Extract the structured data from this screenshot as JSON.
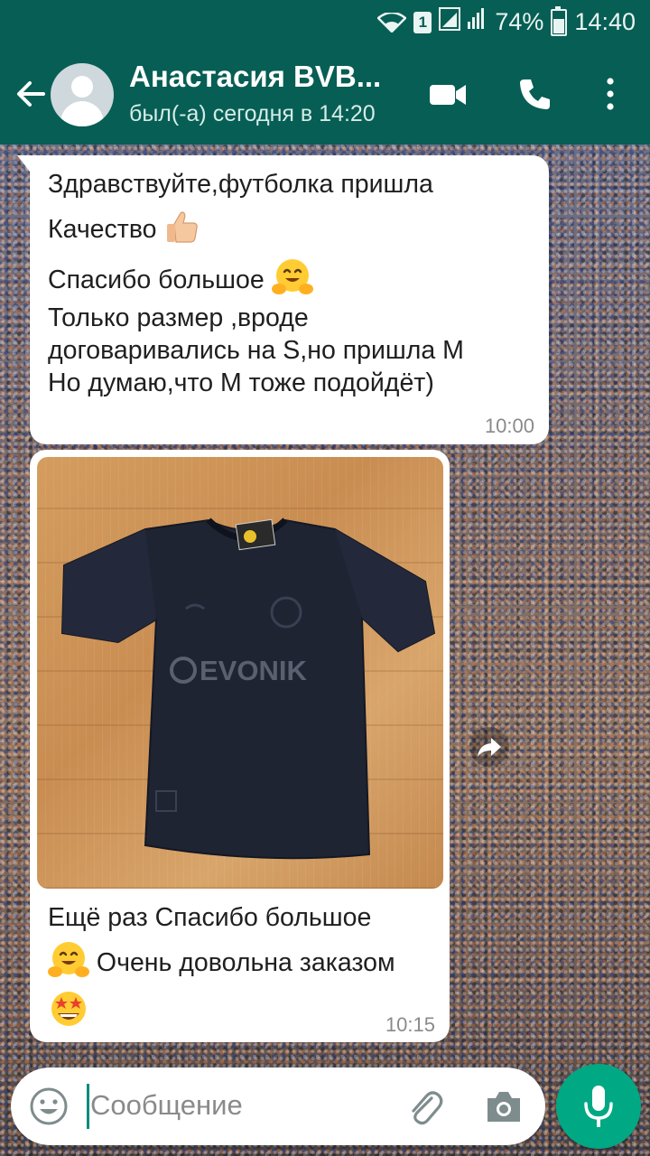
{
  "status_bar": {
    "sim_slot": "1",
    "battery": "74%",
    "battery_level": 0.74,
    "time": "14:40"
  },
  "header": {
    "contact_name": "Анастасия BVB...",
    "last_seen": "был(-а) сегодня в 14:20",
    "icons": [
      "back-arrow-icon",
      "video-call-icon",
      "phone-icon",
      "more-vert-icon"
    ]
  },
  "messages": [
    {
      "lines": [
        "Здравствуйте,футболка пришла",
        "Качество",
        "Спасибо большое",
        "Только размер ,вроде",
        "договаривались на S,но пришла M",
        "Но думаю,что M тоже подойдёт)"
      ],
      "time": "10:00"
    },
    {
      "photo_label": "EVONIK",
      "lines": [
        "Ещё раз Спасибо большое",
        "Очень довольна заказом"
      ],
      "time": "10:15"
    }
  ],
  "composer": {
    "placeholder": "Сообщение"
  },
  "colors": {
    "header": "#075e54",
    "accent": "#00a884",
    "bubble": "#ffffff"
  }
}
